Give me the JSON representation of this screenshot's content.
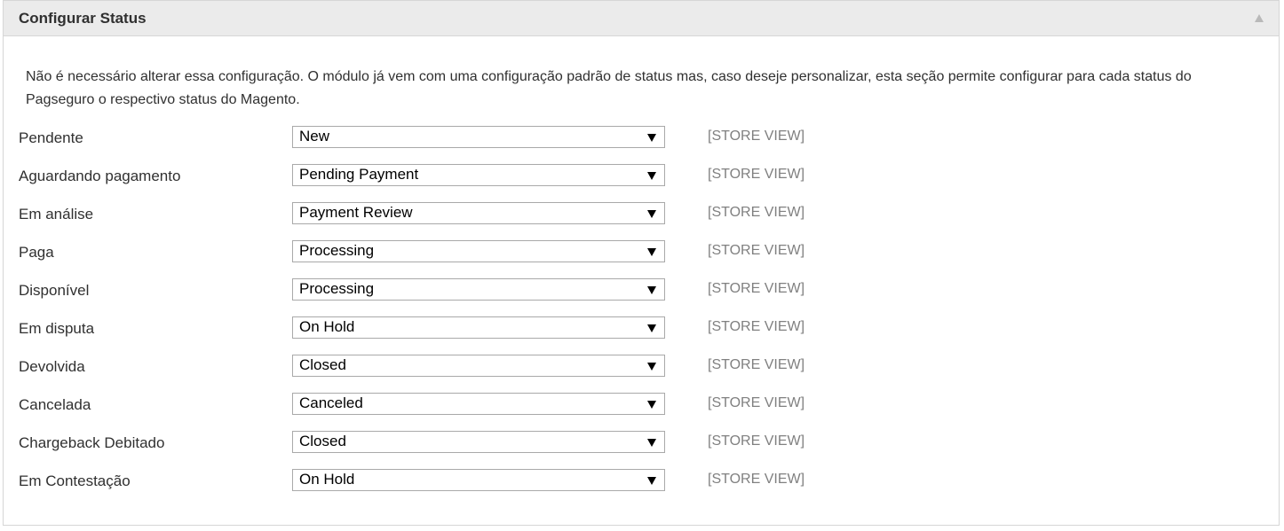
{
  "section": {
    "title": "Configurar Status",
    "collapse_icon": "triangle-up-icon",
    "description": "Não é necessário alterar essa configuração. O módulo já vem com uma configuração padrão de status mas, caso deseje personalizar, esta seção permite configurar para cada status do Pagseguro o respectivo status do Magento."
  },
  "fields": [
    {
      "label": "Pendente",
      "value": "New",
      "scope": "[STORE VIEW]"
    },
    {
      "label": "Aguardando pagamento",
      "value": "Pending Payment",
      "scope": "[STORE VIEW]"
    },
    {
      "label": "Em análise",
      "value": "Payment Review",
      "scope": "[STORE VIEW]"
    },
    {
      "label": "Paga",
      "value": "Processing",
      "scope": "[STORE VIEW]"
    },
    {
      "label": "Disponível",
      "value": "Processing",
      "scope": "[STORE VIEW]"
    },
    {
      "label": "Em disputa",
      "value": "On Hold",
      "scope": "[STORE VIEW]"
    },
    {
      "label": "Devolvida",
      "value": "Closed",
      "scope": "[STORE VIEW]"
    },
    {
      "label": "Cancelada",
      "value": "Canceled",
      "scope": "[STORE VIEW]"
    },
    {
      "label": "Chargeback Debitado",
      "value": "Closed",
      "scope": "[STORE VIEW]"
    },
    {
      "label": "Em Contestação",
      "value": "On Hold",
      "scope": "[STORE VIEW]"
    }
  ]
}
